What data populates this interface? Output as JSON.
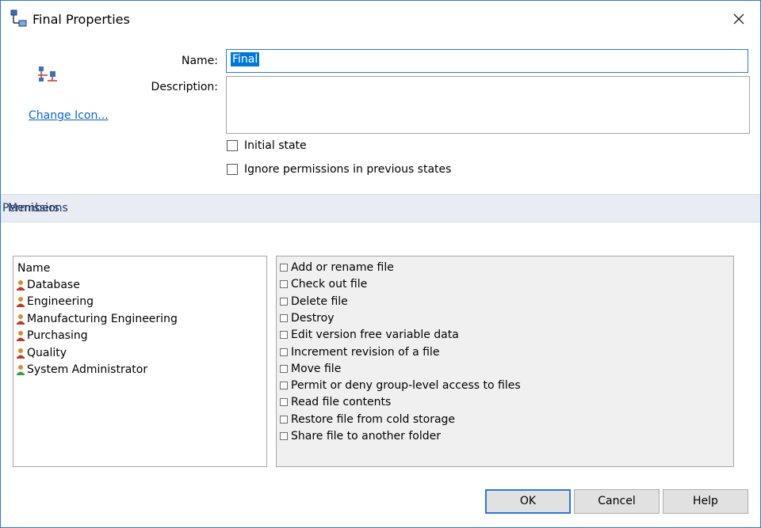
{
  "window": {
    "title": "Final Properties"
  },
  "icons": {
    "title": "workflow-state-icon",
    "state": "state-transition-icon",
    "close": "close-icon",
    "member": "group-icon",
    "admin": "user-icon"
  },
  "general": {
    "change_icon_link": "Change Icon...",
    "name_label": "Name:",
    "name_value": "Final",
    "description_label": "Description:",
    "description_value": "",
    "initial_state_label": "Initial state",
    "initial_state_checked": false,
    "ignore_permissions_label": "Ignore permissions in previous states",
    "ignore_permissions_checked": false
  },
  "tabs": [
    "Permissions",
    "Members"
  ],
  "members": {
    "header": "Name",
    "items": [
      {
        "label": "Database",
        "kind": "group"
      },
      {
        "label": "Engineering",
        "kind": "group"
      },
      {
        "label": "Manufacturing Engineering",
        "kind": "group"
      },
      {
        "label": "Purchasing",
        "kind": "group"
      },
      {
        "label": "Quality",
        "kind": "group"
      },
      {
        "label": "System Administrator",
        "kind": "user"
      }
    ]
  },
  "permissions": {
    "items": [
      "Add or rename file",
      "Check out file",
      "Delete file",
      "Destroy",
      "Edit version free variable data",
      "Increment revision of a file",
      "Move file",
      "Permit or deny group-level access to files",
      "Read file contents",
      "Restore file from cold storage",
      "Share file to another folder"
    ]
  },
  "buttons": {
    "ok": "OK",
    "cancel": "Cancel",
    "help": "Help"
  },
  "colors": {
    "accent": "#2b79d8",
    "link": "#0a66cc",
    "section_bar": "#e8ecf3",
    "selection": "#0078d7"
  }
}
